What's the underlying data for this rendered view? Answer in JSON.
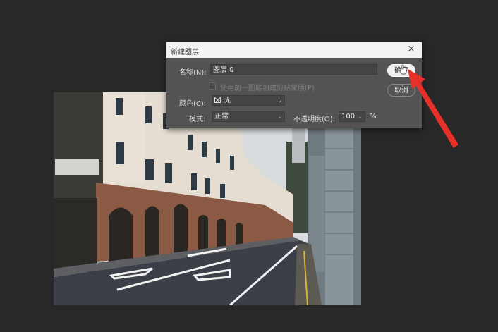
{
  "dialog": {
    "title": "新建图层",
    "name_label": "名称(N):",
    "name_value": "图层 0",
    "clip_checkbox_label": "使用前一图层创建剪贴蒙版(P)",
    "color_label": "颜色(C):",
    "color_value": "无",
    "mode_label": "模式:",
    "mode_value": "正常",
    "opacity_label": "不透明度(O):",
    "opacity_value": "100",
    "opacity_unit": "%",
    "ok_label": "确定",
    "cancel_label": "取消"
  },
  "colors": {
    "background": "#282828",
    "dialog": "#535353",
    "annotation_arrow": "#e8302a"
  },
  "icons": {
    "close": "close-icon",
    "dropdown": "chevron-down-icon",
    "color_none": "no-color-swatch-icon",
    "cursor": "hand-cursor-icon"
  }
}
